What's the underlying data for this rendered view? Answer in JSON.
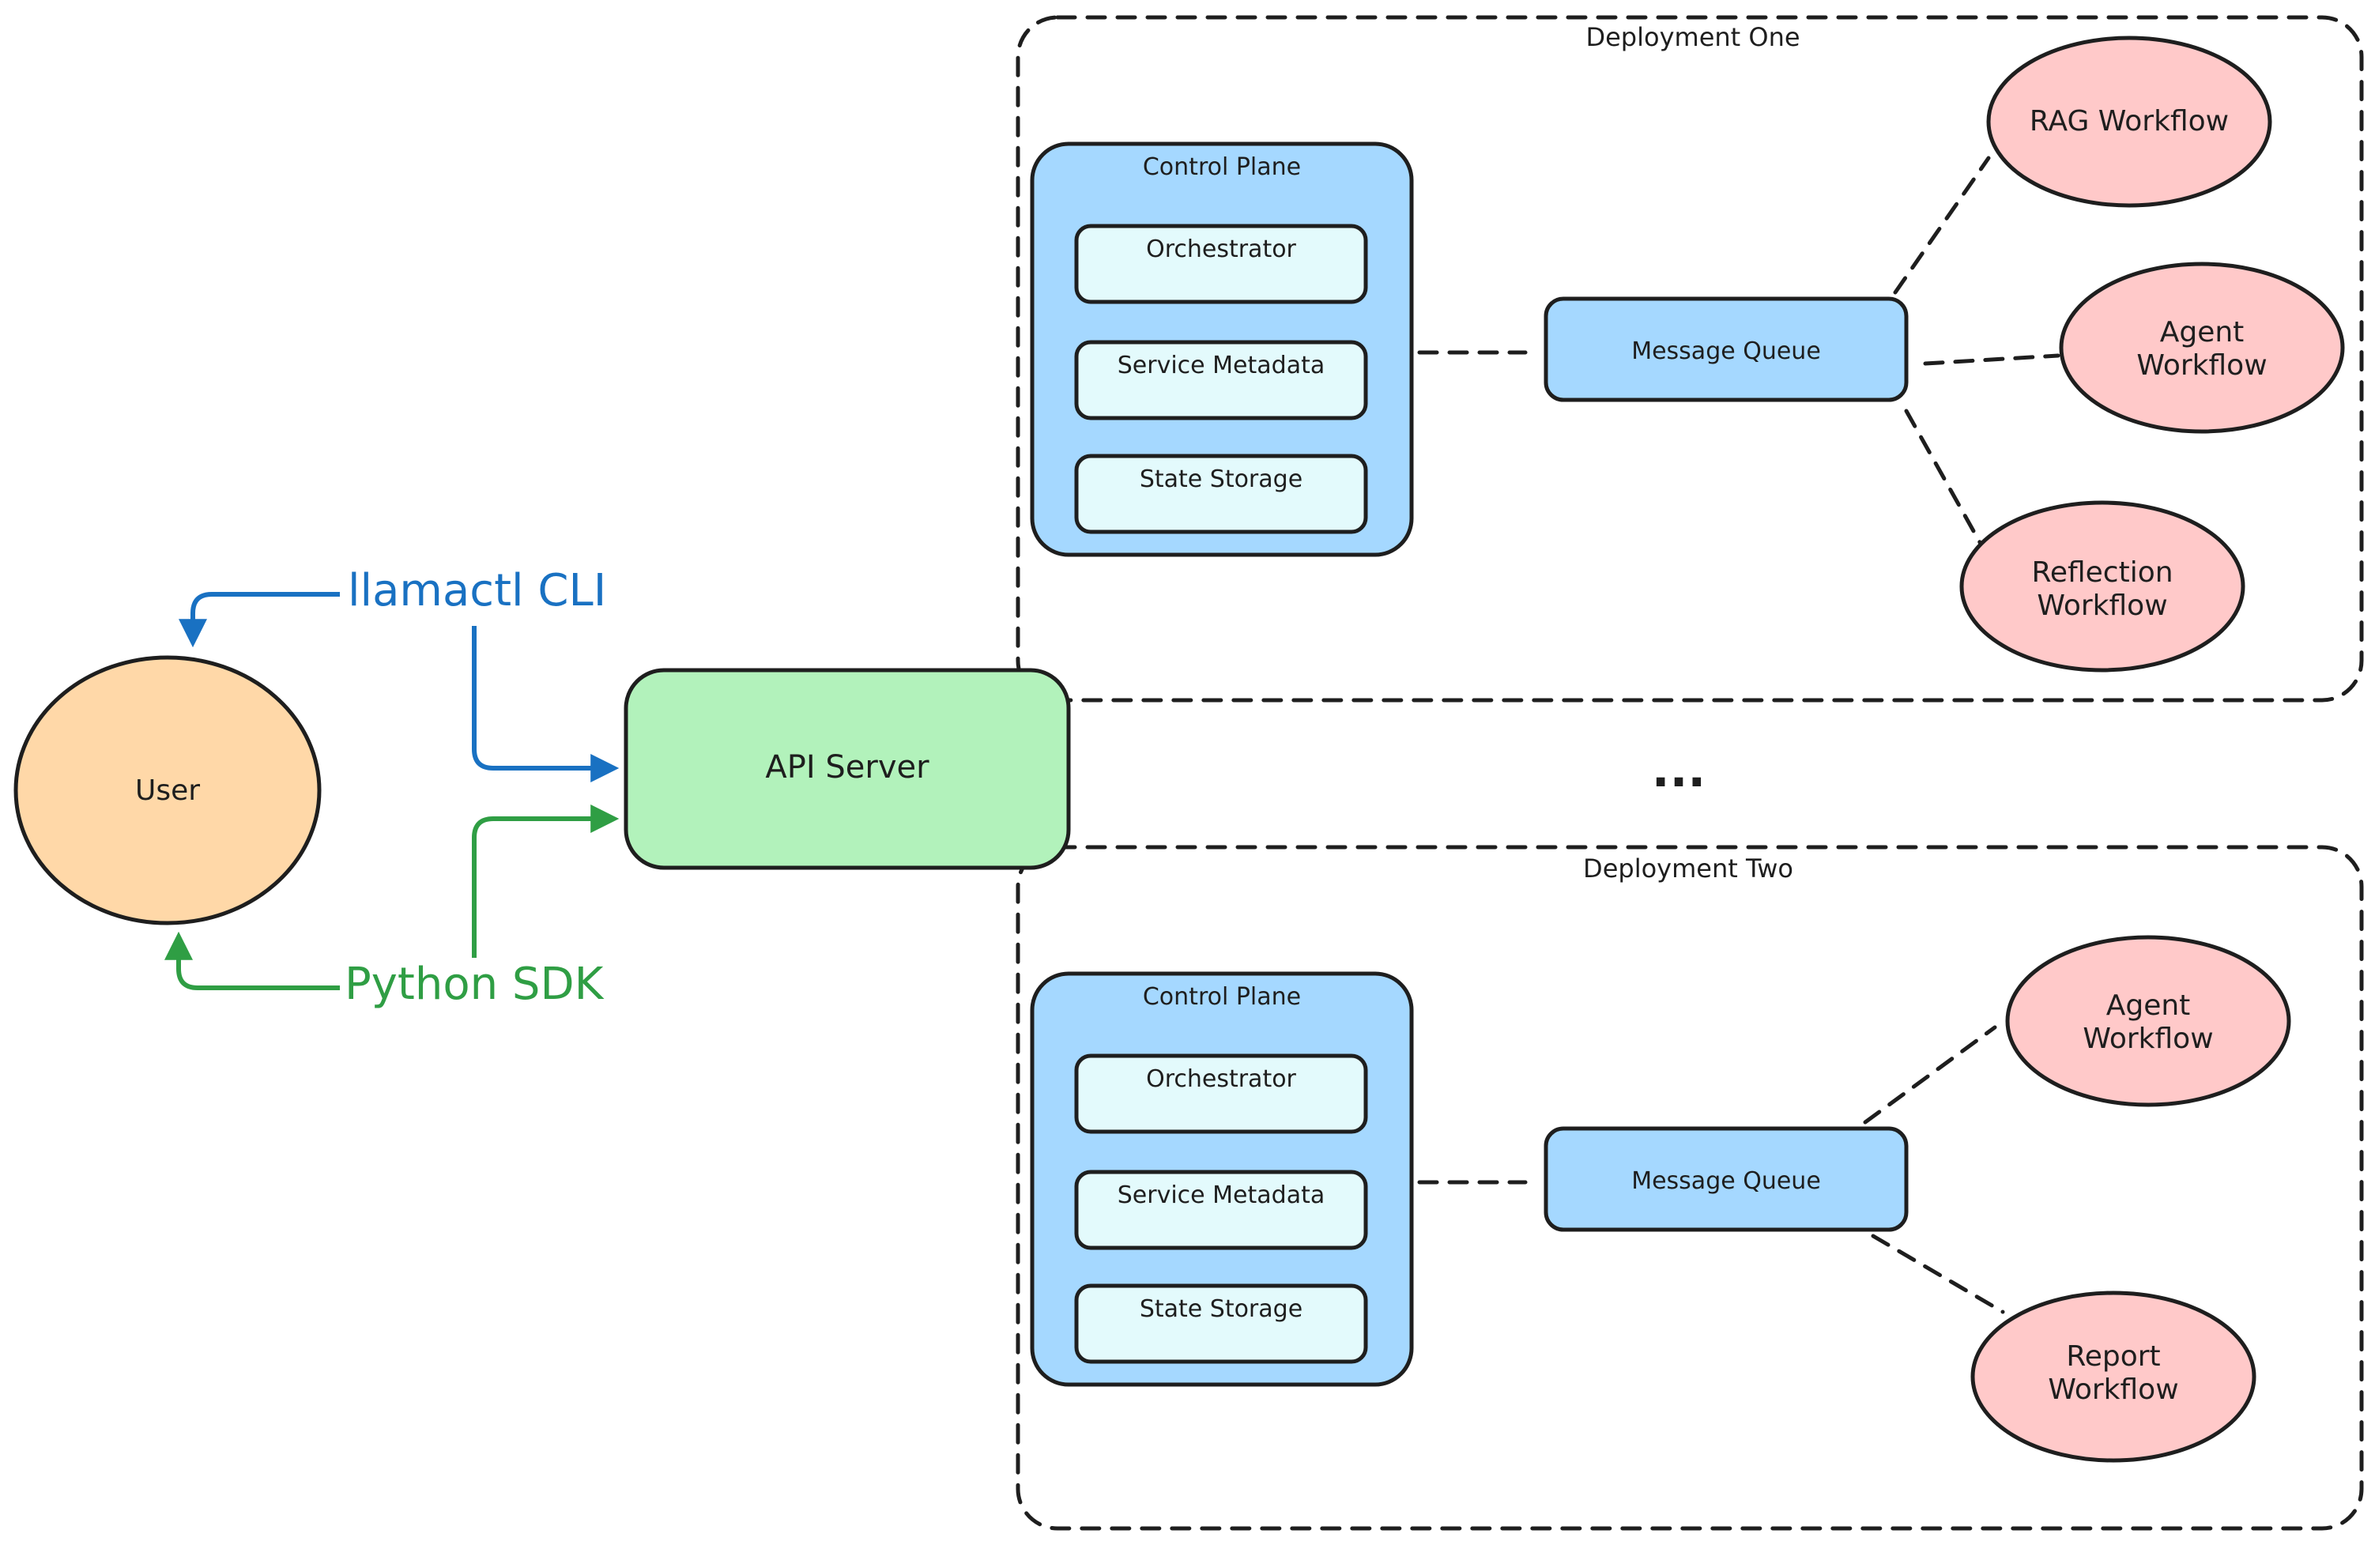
{
  "colors": {
    "user_fill": "#ffd8a8",
    "api_fill": "#b2f2bb",
    "control_plane_fill": "#a5d8ff",
    "inner_box_fill": "#e3fafc",
    "queue_fill": "#a5d8ff",
    "workflow_fill": "#ffc9c9",
    "cli_color": "#1971c2",
    "sdk_color": "#2f9e44",
    "stroke": "#1e1e1e"
  },
  "user": {
    "label": "User"
  },
  "cli": {
    "label": "llamactl CLI"
  },
  "sdk": {
    "label": "Python SDK"
  },
  "api_server": {
    "label": "API Server"
  },
  "ellipsis": {
    "label": "..."
  },
  "deployments": [
    {
      "title": "Deployment One",
      "control_plane": {
        "title": "Control Plane",
        "components": [
          "Orchestrator",
          "Service Metadata",
          "State Storage"
        ]
      },
      "message_queue": "Message Queue",
      "workflows": [
        {
          "lines": [
            "RAG Workflow"
          ]
        },
        {
          "lines": [
            "Agent",
            "Workflow"
          ]
        },
        {
          "lines": [
            "Reflection",
            "Workflow"
          ]
        }
      ]
    },
    {
      "title": "Deployment Two",
      "control_plane": {
        "title": "Control Plane",
        "components": [
          "Orchestrator",
          "Service Metadata",
          "State Storage"
        ]
      },
      "message_queue": "Message Queue",
      "workflows": [
        {
          "lines": [
            "Agent",
            "Workflow"
          ]
        },
        {
          "lines": [
            "Report",
            "Workflow"
          ]
        }
      ]
    }
  ]
}
